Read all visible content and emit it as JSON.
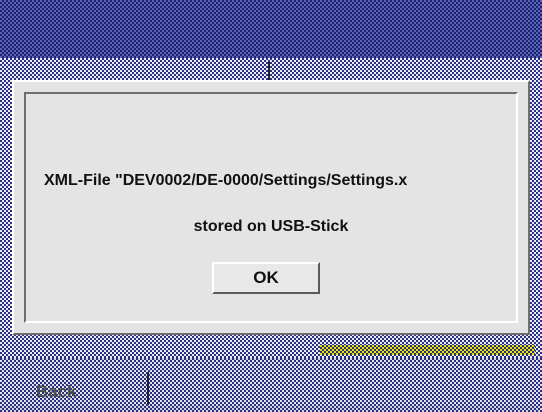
{
  "dialog": {
    "message_line1": "XML-File \"DEV0002/DE-0000/Settings/Settings.x",
    "message_line2": "stored on USB-Stick",
    "ok_label": "OK"
  },
  "bottom_bar": {
    "back_label": "Back"
  },
  "colors": {
    "dither_blue": "#2a2f86",
    "title_blue": "#5b63b8",
    "dialog_gray": "#e4e4e4",
    "highlight_yellow": "#e9e600"
  }
}
